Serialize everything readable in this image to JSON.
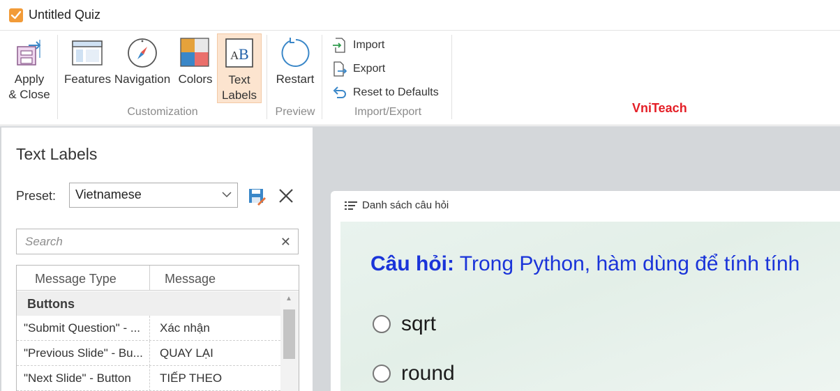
{
  "window": {
    "title": "Untitled Quiz"
  },
  "ribbon": {
    "apply_close": {
      "line1": "Apply",
      "line2": "& Close"
    },
    "features": "Features",
    "navigation": "Navigation",
    "colors": "Colors",
    "text_labels": {
      "line1": "Text",
      "line2": "Labels"
    },
    "restart": "Restart",
    "import": "Import",
    "export": "Export",
    "reset": "Reset to Defaults",
    "groups": {
      "customization": "Customization",
      "preview": "Preview",
      "import_export": "Import/Export"
    },
    "brand": "VniTeach",
    "accent_color": "#f29b38",
    "brand_color": "#e41e26"
  },
  "panel": {
    "title": "Text Labels",
    "preset_label": "Preset:",
    "preset_value": "Vietnamese",
    "search_placeholder": "Search",
    "columns": {
      "type": "Message Type",
      "message": "Message"
    },
    "group": "Buttons",
    "rows": [
      {
        "type": "\"Submit Question\" - ...",
        "message": "Xác nhận"
      },
      {
        "type": "\"Previous Slide\" - Bu...",
        "message": "QUAY LẠI"
      },
      {
        "type": "\"Next Slide\" - Button",
        "message": "TIẾP THEO"
      }
    ]
  },
  "preview": {
    "list_button": "Danh sách câu hỏi",
    "question_prefix": "Câu hỏi:",
    "question_text": "Trong Python, hàm dùng để tính tính",
    "options": [
      "sqrt",
      "round"
    ],
    "question_color": "#1a34d9"
  }
}
